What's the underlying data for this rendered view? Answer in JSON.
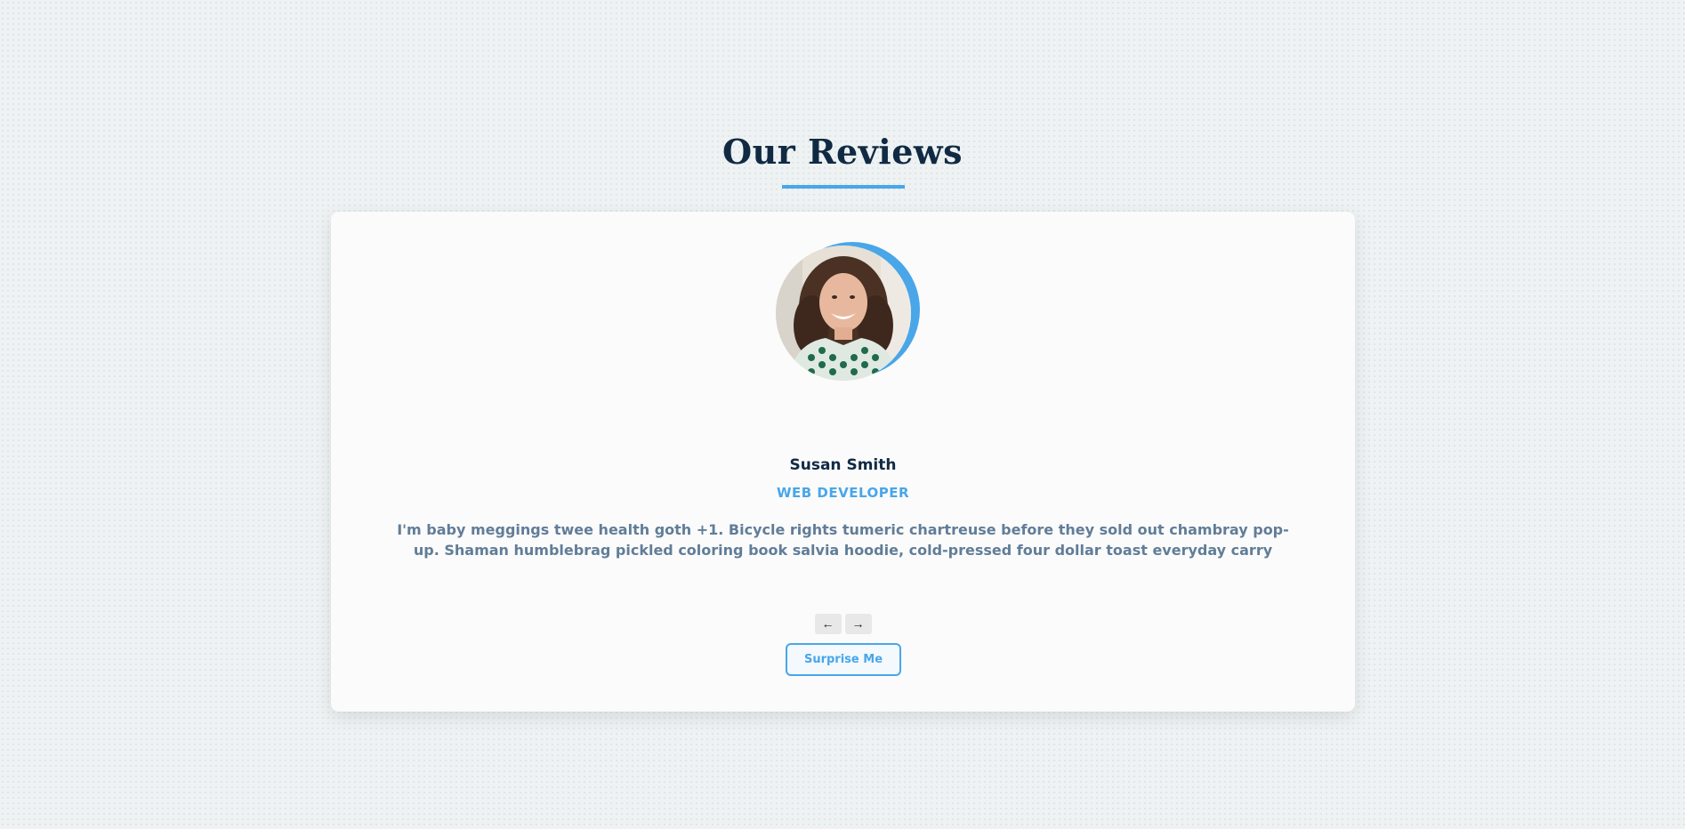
{
  "section": {
    "title": "Our Reviews"
  },
  "review": {
    "author": "Susan Smith",
    "job": "WEB DEVELOPER",
    "text": "I'm baby meggings twee health goth +1. Bicycle rights tumeric chartreuse before they sold out chambray pop-up. Shaman humblebrag pickled coloring book salvia hoodie, cold-pressed four dollar toast everyday carry"
  },
  "controls": {
    "prev_icon": "←",
    "next_icon": "→",
    "surprise_label": "Surprise Me"
  },
  "icons": {
    "prev": "arrow-left-icon",
    "next": "arrow-right-icon"
  },
  "colors": {
    "accent": "#49a6e9",
    "heading": "#102a43",
    "body_text": "#617d98",
    "card_background": "#fbfbfb",
    "page_background": "#eef2f3"
  }
}
